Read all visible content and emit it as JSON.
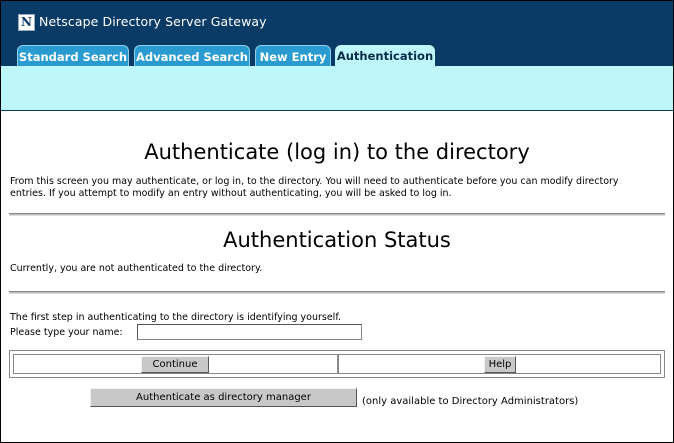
{
  "header": {
    "logo_letter": "N",
    "title": "Netscape Directory Server Gateway"
  },
  "tabs": [
    {
      "label": "Standard Search",
      "active": false
    },
    {
      "label": "Advanced Search",
      "active": false
    },
    {
      "label": "New Entry",
      "active": false
    },
    {
      "label": "Authentication",
      "active": true
    }
  ],
  "main": {
    "heading": "Authenticate (log in) to the directory",
    "intro": "From this screen you may authenticate, or log in, to the directory. You will need to authenticate before you can modify directory entries. If you attempt to modify an entry without authenticating, you will be asked to log in.",
    "status_heading": "Authentication Status",
    "status_text": "Currently, you are not authenticated to the directory.",
    "step_text": "The first step in authenticating to the directory is identifying yourself.",
    "name_label": "Please type your name:",
    "name_value": ""
  },
  "buttons": {
    "continue_label": "Continue",
    "help_label": "Help",
    "manager_label": "Authenticate as directory manager",
    "manager_note": "(only available to Directory Administrators)"
  },
  "colors": {
    "header_bg": "#0a3a66",
    "tab_bg": "#2a9bd0",
    "tab_active_bg": "#bdf7f9"
  }
}
